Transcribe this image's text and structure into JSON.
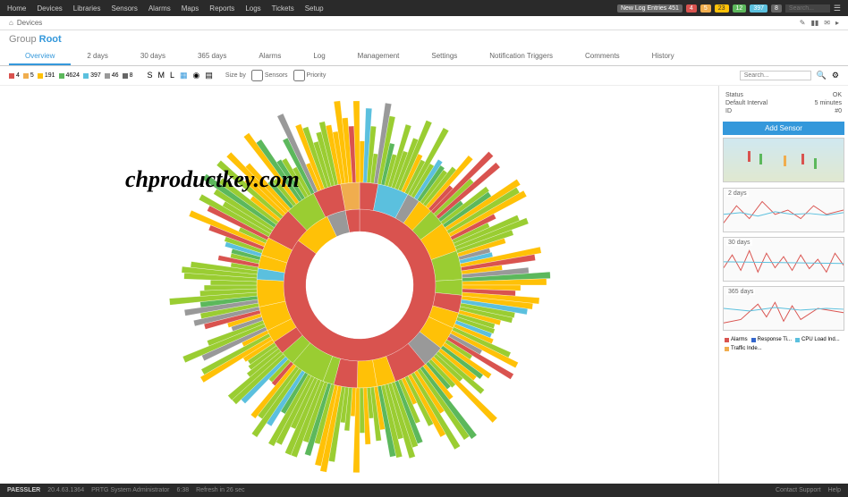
{
  "topnav": {
    "items": [
      "Home",
      "Devices",
      "Libraries",
      "Sensors",
      "Alarms",
      "Maps",
      "Reports",
      "Logs",
      "Tickets",
      "Setup"
    ],
    "newlog": "New Log Entries 451",
    "badges": [
      {
        "color": "red",
        "val": "4"
      },
      {
        "color": "orange",
        "val": "5"
      },
      {
        "color": "yellow",
        "val": "23"
      },
      {
        "color": "green",
        "val": "12"
      },
      {
        "color": "blue",
        "val": "397"
      },
      {
        "color": "gray",
        "val": "8"
      }
    ],
    "search_placeholder": "Search..."
  },
  "breadcrumb": {
    "path": "Devices"
  },
  "title": {
    "group": "Group",
    "root": "Root"
  },
  "tabs": [
    {
      "label": "Overview",
      "active": true
    },
    {
      "label": "2 days",
      "active": false
    },
    {
      "label": "30 days",
      "active": false
    },
    {
      "label": "365 days",
      "active": false
    },
    {
      "label": "Alarms",
      "active": false
    },
    {
      "label": "Log",
      "active": false
    },
    {
      "label": "Management",
      "active": false
    },
    {
      "label": "Settings",
      "active": false
    },
    {
      "label": "Notification Triggers",
      "active": false
    },
    {
      "label": "Comments",
      "active": false
    },
    {
      "label": "History",
      "active": false
    }
  ],
  "toolbar": {
    "status": [
      {
        "color": "#d9534f",
        "label": "4"
      },
      {
        "color": "#f0ad4e",
        "label": "5"
      },
      {
        "color": "#ffc107",
        "label": "191"
      },
      {
        "color": "#5cb85c",
        "label": "4624"
      },
      {
        "color": "#5bc0de",
        "label": "397"
      },
      {
        "color": "#999",
        "label": "46"
      },
      {
        "color": "#666",
        "label": "8"
      }
    ],
    "size_by": "Size by",
    "sensors_label": "Sensors",
    "priority_label": "Priority",
    "search_placeholder": "Search..."
  },
  "watermark": "chproductkey.com",
  "sidebar": {
    "status_label": "Status",
    "status_value": "OK",
    "interval_label": "Default Interval",
    "interval_value": "5 minutes",
    "id_label": "ID",
    "id_value": "#0",
    "add_sensor": "Add Sensor",
    "charts": [
      "2 days",
      "30 days",
      "365 days"
    ],
    "legend": [
      {
        "color": "#d9534f",
        "label": "Alarms"
      },
      {
        "color": "#3366cc",
        "label": "Response Ti..."
      },
      {
        "color": "#5bc0de",
        "label": "CPU Load Ind..."
      },
      {
        "color": "#f0ad4e",
        "label": "Traffic Inde..."
      }
    ]
  },
  "footer": {
    "brand": "PAESSLER",
    "version": "20.4.63.1364",
    "system": "PRTG System Administrator",
    "time": "6:38",
    "refresh": "Refresh in 26 sec",
    "support": "Contact Support",
    "help": "Help"
  },
  "chart_data": {
    "type": "sunburst",
    "note": "Hierarchical sensor tree visualization; inner ring = groups (red/down status dominant), outer spokes = individual sensors colored by status",
    "color_scheme": {
      "down": "#d9534f",
      "warning": "#f0ad4e",
      "up": "#9acd32",
      "up_bright": "#5cb85c",
      "unusual": "#ffc107",
      "paused": "#5bc0de",
      "unknown": "#999"
    },
    "ring_distribution_approx": {
      "inner_ring_pct": {
        "red": 85,
        "yellow": 10,
        "gray": 5
      },
      "mid_ring_pct": {
        "yellow": 40,
        "green": 35,
        "red": 15,
        "blue": 5,
        "gray": 5
      },
      "outer_spokes_pct": {
        "green": 60,
        "yellow": 25,
        "red": 5,
        "blue": 5,
        "gray": 5
      }
    }
  }
}
